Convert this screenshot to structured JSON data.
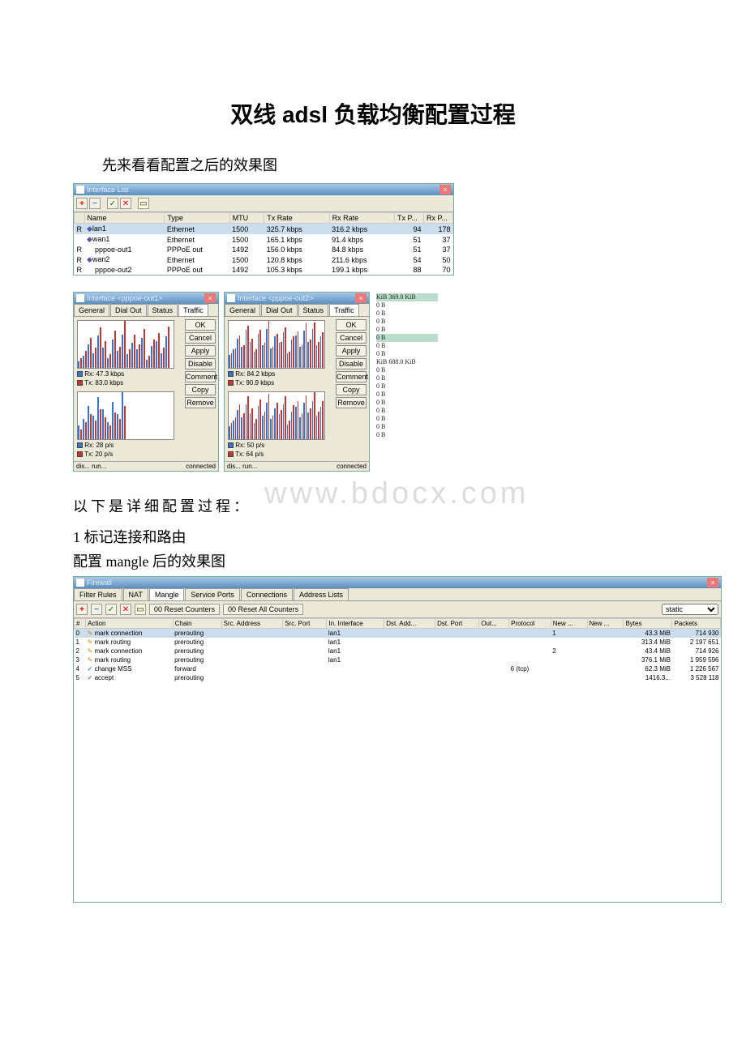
{
  "doc": {
    "title": "双线 adsl 负载均衡配置过程",
    "intro": "先来看看配置之后的效果图",
    "mid": "以下是详细配置过程：",
    "sec1": "1 标记连接和路由",
    "sec1b": "配置 mangle 后的效果图",
    "watermark": "www.bdocx.com"
  },
  "iflist": {
    "title": "Interface List",
    "cols": [
      "",
      "Name",
      "Type",
      "MTU",
      "Tx Rate",
      "Rx Rate",
      "Tx P...",
      "Rx P..."
    ],
    "rows": [
      {
        "flag": "R",
        "name": "lan1",
        "type": "Ethernet",
        "mtu": "1500",
        "tx": "325.7 kbps",
        "rx": "316.2 kbps",
        "txp": "94",
        "rxp": "178",
        "diamond": true,
        "sel": true
      },
      {
        "flag": "",
        "name": "wan1",
        "type": "Ethernet",
        "mtu": "1500",
        "tx": "165.1 kbps",
        "rx": "91.4 kbps",
        "txp": "51",
        "rxp": "37",
        "diamond": true
      },
      {
        "flag": "R",
        "name": "pppoe-out1",
        "type": "PPPoE out",
        "mtu": "1492",
        "tx": "156.0 kbps",
        "rx": "84.8 kbps",
        "txp": "51",
        "rxp": "37"
      },
      {
        "flag": "R",
        "name": "wan2",
        "type": "Ethernet",
        "mtu": "1500",
        "tx": "120.8 kbps",
        "rx": "211.6 kbps",
        "txp": "54",
        "rxp": "50",
        "diamond": true
      },
      {
        "flag": "R",
        "name": "pppoe-out2",
        "type": "PPPoE out",
        "mtu": "1492",
        "tx": "105.3 kbps",
        "rx": "199.1 kbps",
        "txp": "88",
        "rxp": "70"
      }
    ]
  },
  "twin_tabs": [
    "General",
    "Dial Out",
    "Status",
    "Traffic"
  ],
  "twin_btns": [
    "OK",
    "Cancel",
    "Apply",
    "Disable",
    "Comment",
    "Copy",
    "Remove"
  ],
  "twin1": {
    "title": "Interface <pppoe-out1>",
    "rx": "Rx: 47.3 kbps",
    "tx": "Tx: 83.0 kbps",
    "rxp": "Rx: 28 p/s",
    "txp": "Tx: 20 p/s",
    "status_l": "dis...   run...",
    "status_r": "connected"
  },
  "twin2": {
    "title": "Interface <pppoe-out2>",
    "rx": "Rx: 84.2 kbps",
    "tx": "Tx: 90.9 kbps",
    "rxp": "Rx: 50 p/s",
    "txp": "Tx: 64 p/s",
    "status_l": "dis...   run...",
    "status_r": "connected"
  },
  "side": {
    "header": "KiB  369.0 KiB",
    "lines": [
      "0 B",
      "0 B",
      "0 B",
      "0 B",
      "0 B",
      "0 B",
      "0 B",
      "KiB  688.0 KiB",
      "0 B",
      "0 B",
      "0 B",
      "0 B",
      "0 B",
      "0 B",
      "0 B",
      "0 B",
      "0 B"
    ]
  },
  "firewall": {
    "title": "Firewall",
    "tabs": [
      "Filter Rules",
      "NAT",
      "Mangle",
      "Service Ports",
      "Connections",
      "Address Lists"
    ],
    "active_tab": 2,
    "reset": "00 Reset Counters",
    "resetall": "00 Reset All Counters",
    "dropdown": "static",
    "cols": [
      "#",
      "Action",
      "Chain",
      "Src. Address",
      "Src. Port",
      "In. Interface",
      "Dst. Add...",
      "Dst. Port",
      "Out...",
      "Protocol",
      "New ...",
      "New ...",
      "Bytes",
      "Packets"
    ],
    "rows": [
      {
        "n": "0",
        "action": "mark connection",
        "chain": "prerouting",
        "inif": "lan1",
        "new": "1",
        "bytes": "43.3 MiB",
        "pkt": "714 930",
        "sel": true
      },
      {
        "n": "1",
        "action": "mark routing",
        "chain": "prerouting",
        "inif": "lan1",
        "bytes": "313.4 MiB",
        "pkt": "2 197 651"
      },
      {
        "n": "2",
        "action": "mark connection",
        "chain": "prerouting",
        "inif": "lan1",
        "new": "2",
        "bytes": "43.4 MiB",
        "pkt": "714 926"
      },
      {
        "n": "3",
        "action": "mark routing",
        "chain": "prerouting",
        "inif": "lan1",
        "bytes": "376.1 MiB",
        "pkt": "1 959 596"
      },
      {
        "n": "4",
        "action": "change MSS",
        "chain": "forward",
        "proto": "6 (tcp)",
        "bytes": "62.3 MiB",
        "pkt": "1 226 567"
      },
      {
        "n": "5",
        "action": "accept",
        "chain": "prerouting",
        "bytes": "1416.3...",
        "pkt": "3 528 118"
      }
    ]
  },
  "chart_data": [
    {
      "type": "bar",
      "title": "pppoe-out1 rate",
      "series": [
        {
          "name": "Rx",
          "values": [
            10,
            18,
            35,
            22,
            48,
            30,
            15,
            42,
            25,
            50,
            20,
            38,
            28,
            45,
            12,
            33,
            40,
            22,
            47
          ]
        },
        {
          "name": "Tx",
          "values": [
            15,
            25,
            45,
            30,
            60,
            40,
            20,
            55,
            32,
            70,
            28,
            50,
            35,
            58,
            18,
            42,
            52,
            30,
            62
          ]
        }
      ]
    },
    {
      "type": "bar",
      "title": "pppoe-out1 packets",
      "series": [
        {
          "name": "Rx",
          "values": [
            8,
            12,
            20,
            14,
            25,
            18,
            10,
            22,
            15,
            28
          ]
        },
        {
          "name": "Tx",
          "values": [
            6,
            10,
            15,
            11,
            18,
            13,
            8,
            16,
            12,
            20
          ]
        }
      ]
    },
    {
      "type": "bar",
      "title": "pppoe-out2 rate",
      "series": [
        {
          "name": "Rx",
          "values": [
            20,
            28,
            45,
            32,
            58,
            40,
            25,
            52,
            35,
            60,
            30,
            48,
            38,
            55,
            22,
            43,
            50,
            32,
            57,
            40,
            60,
            35,
            48
          ]
        },
        {
          "name": "Tx",
          "values": [
            22,
            30,
            50,
            35,
            65,
            45,
            28,
            58,
            38,
            72,
            32,
            52,
            40,
            62,
            25,
            48,
            56,
            35,
            68,
            44,
            70,
            40,
            55
          ]
        }
      ]
    },
    {
      "type": "bar",
      "title": "pppoe-out2 packets",
      "series": [
        {
          "name": "Rx",
          "values": [
            18,
            25,
            40,
            30,
            48,
            35,
            22,
            45,
            32,
            50,
            28,
            42,
            34,
            48,
            20,
            38,
            44,
            30,
            50,
            36,
            52,
            32,
            44
          ]
        },
        {
          "name": "Tx",
          "values": [
            22,
            30,
            48,
            35,
            58,
            42,
            28,
            54,
            38,
            62,
            32,
            50,
            40,
            58,
            25,
            46,
            52,
            35,
            60,
            42,
            64,
            38,
            52
          ]
        }
      ]
    }
  ]
}
